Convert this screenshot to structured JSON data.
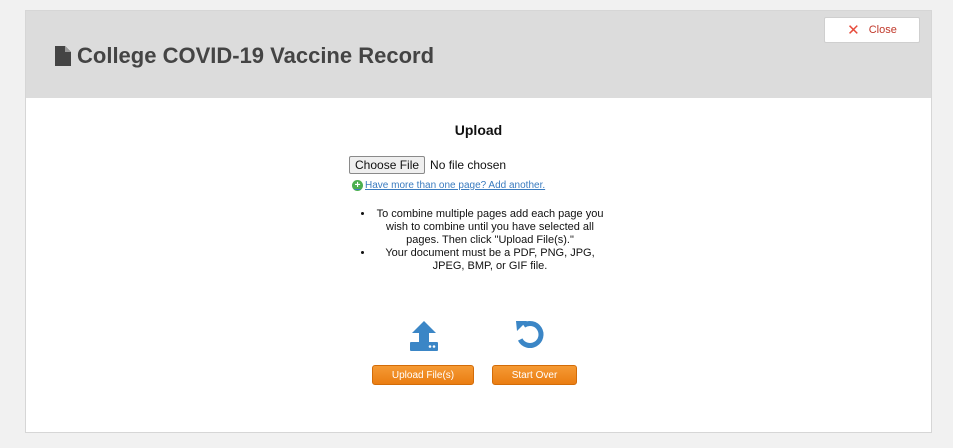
{
  "header": {
    "title": "College COVID-19 Vaccine Record",
    "close_label": "Close"
  },
  "upload": {
    "heading": "Upload",
    "choose_file_label": "Choose File",
    "file_status": "No file chosen",
    "add_another_link": "Have more than one page? Add another.",
    "notes": [
      "To combine multiple pages add each page you wish to combine until you have selected all pages. Then click \"Upload File(s).\"",
      "Your document must be a PDF, PNG, JPG, JPEG, BMP, or GIF file."
    ],
    "upload_button": "Upload File(s)",
    "start_over_button": "Start Over"
  },
  "icons": {
    "title": "document-icon",
    "close": "close-x-icon",
    "add": "plus-circle-icon",
    "upload": "upload-icon",
    "restart": "restart-icon"
  },
  "colors": {
    "header_bg": "#dcdcdc",
    "accent_orange": "#f08a1e",
    "icon_blue": "#3b86c6",
    "close_red": "#e74c3c",
    "link_blue": "#3a7bbf"
  }
}
